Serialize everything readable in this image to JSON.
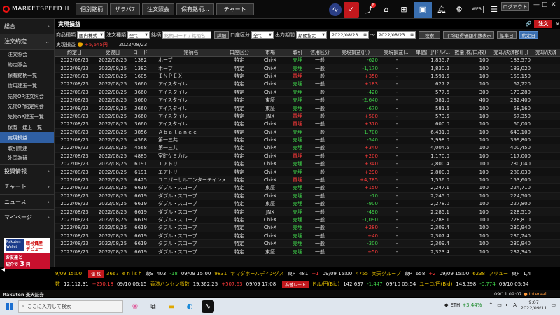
{
  "app": {
    "logo_text": "MARKETSPEED II",
    "tabs": [
      "個別銘柄",
      "ザラバ7",
      "注文照会",
      "保有銘柄...",
      "チャート"
    ],
    "logout": "ログアウト",
    "web_label": "WEB",
    "notification_badge": "N",
    "win_min": "—",
    "win_max": "□",
    "win_close": "✕"
  },
  "sidebar": {
    "sections": [
      {
        "label": "総合",
        "arrow": "›"
      },
      {
        "label": "注文約定",
        "arrow": "⌄"
      }
    ],
    "items": [
      "注文照会",
      "約定照会",
      "保有銘柄一覧",
      "信用建玉一覧",
      "先物OP注文照会",
      "先物OP約定照会",
      "先物OP建玉一覧",
      "保有・建玉一覧",
      "実現損益",
      "取引関連",
      "外国為替"
    ],
    "active_index": 8,
    "bottom_sections": [
      {
        "label": "投資情報",
        "arrow": "›"
      },
      {
        "label": "チャート",
        "arrow": "›"
      },
      {
        "label": "ニュース",
        "arrow": "›"
      },
      {
        "label": "マイページ",
        "arrow": "›"
      }
    ],
    "banner": {
      "brand": "Rakuten Wallet",
      "line1": "暗号資産",
      "line2": "デビュー",
      "line3": "お友達と",
      "line4": "紹介で",
      "amount": "3",
      "unit": "円"
    }
  },
  "panel": {
    "title": "実現損益",
    "link_icon": "🔗",
    "order_button": "注文",
    "filter": {
      "product_label": "商品種類",
      "product_value": "国内株式",
      "order_type_label": "注文種類",
      "order_type_value": "全て",
      "symbol_label": "銘柄",
      "symbol_placeholder": "銘柄コード / 銘柄名",
      "detail_button": "詳細",
      "account_label": "口座区分",
      "account_value": "全て",
      "period_label": "出力期間",
      "period_value": "期間指定",
      "date_from": "2022/08/23",
      "date_sep": "〜",
      "date_to": "2022/08/23",
      "search_button": "検索",
      "avg_button": "平均取得価額小数表示",
      "base_date_label": "基準日",
      "base_date_value": "約定日"
    },
    "summary": {
      "label": "実現損益",
      "help": "?",
      "value": "+5,645円",
      "date": "2022/08/23"
    }
  },
  "table": {
    "headers": [
      "約定日",
      "受渡日",
      "コード/...",
      "銘柄名",
      "口座区分",
      "市場",
      "取引",
      "信用区分",
      "実現損益(円)",
      "実現損益(...",
      "単価(円/ドル/...",
      "数量(株/口/枚)",
      "売却/決済額(円)",
      "売却/決済"
    ],
    "rows": [
      [
        "2022/08/23",
        "2022/08/25",
        "1382",
        "ホーブ",
        "特定",
        "Chi-X",
        "売埋",
        "一般",
        "-620",
        "-",
        "1,835.7",
        "100",
        "183,570"
      ],
      [
        "2022/08/23",
        "2022/08/25",
        "1382",
        "ホーブ",
        "特定",
        "Chi-X",
        "売埋",
        "一般",
        "-1,170",
        "-",
        "1,830.2",
        "100",
        "183,020"
      ],
      [
        "2022/08/23",
        "2022/08/25",
        "1605",
        "ＩＮＰＥＸ",
        "特定",
        "Chi-X",
        "買埋",
        "一般",
        "+350",
        "-",
        "1,591.5",
        "100",
        "159,150"
      ],
      [
        "2022/08/23",
        "2022/08/25",
        "3660",
        "アイスタイル",
        "特定",
        "Chi-X",
        "売埋",
        "一般",
        "+183",
        "-",
        "627.2",
        "100",
        "62,720"
      ],
      [
        "2022/08/23",
        "2022/08/25",
        "3660",
        "アイスタイル",
        "特定",
        "Chi-X",
        "売埋",
        "一般",
        "-420",
        "-",
        "577.6",
        "300",
        "173,280"
      ],
      [
        "2022/08/23",
        "2022/08/25",
        "3660",
        "アイスタイル",
        "特定",
        "東証",
        "売埋",
        "一般",
        "-2,640",
        "-",
        "581.0",
        "400",
        "232,400"
      ],
      [
        "2022/08/23",
        "2022/08/25",
        "3660",
        "アイスタイル",
        "特定",
        "東証",
        "売埋",
        "一般",
        "-670",
        "-",
        "581.6",
        "100",
        "58,160"
      ],
      [
        "2022/08/23",
        "2022/08/25",
        "3660",
        "アイスタイル",
        "特定",
        "JNX",
        "買埋",
        "一般",
        "+500",
        "-",
        "573.5",
        "100",
        "57,350"
      ],
      [
        "2022/08/23",
        "2022/08/25",
        "3660",
        "アイスタイル",
        "特定",
        "Chi-X",
        "買埋",
        "一般",
        "+370",
        "-",
        "600.0",
        "100",
        "60,000"
      ],
      [
        "2022/08/23",
        "2022/08/25",
        "3856",
        "Ａｂａｌａｎｃｅ",
        "特定",
        "Chi-X",
        "売埋",
        "一般",
        "-1,700",
        "-",
        "6,431.0",
        "100",
        "643,100"
      ],
      [
        "2022/08/23",
        "2022/08/25",
        "4568",
        "第一三共",
        "特定",
        "Chi-X",
        "売埋",
        "一般",
        "-540",
        "-",
        "3,998.0",
        "100",
        "399,800"
      ],
      [
        "2022/08/23",
        "2022/08/25",
        "4568",
        "第一三共",
        "特定",
        "Chi-X",
        "売埋",
        "一般",
        "+340",
        "-",
        "4,004.5",
        "100",
        "400,450"
      ],
      [
        "2022/08/23",
        "2022/08/25",
        "4885",
        "室町ケミカル",
        "特定",
        "Chi-X",
        "買埋",
        "一般",
        "+200",
        "-",
        "1,170.0",
        "100",
        "117,000"
      ],
      [
        "2022/08/23",
        "2022/08/25",
        "6191",
        "エアトリ",
        "特定",
        "Chi-X",
        "売埋",
        "一般",
        "+340",
        "-",
        "2,800.4",
        "100",
        "280,040"
      ],
      [
        "2022/08/23",
        "2022/08/25",
        "6191",
        "エアトリ",
        "特定",
        "Chi-X",
        "売埋",
        "一般",
        "+290",
        "-",
        "2,800.3",
        "100",
        "280,030"
      ],
      [
        "2022/08/23",
        "2022/08/25",
        "6425",
        "ユニバーサルエンターテインメン",
        "特定",
        "Chi-X",
        "買埋",
        "一般",
        "+4,785",
        "-",
        "1,536.0",
        "100",
        "153,600"
      ],
      [
        "2022/08/23",
        "2022/08/25",
        "6619",
        "ダブル・スコープ",
        "特定",
        "東証",
        "売埋",
        "一般",
        "+150",
        "-",
        "2,247.1",
        "100",
        "224,710"
      ],
      [
        "2022/08/23",
        "2022/08/25",
        "6619",
        "ダブル・スコープ",
        "特定",
        "Chi-X",
        "売埋",
        "一般",
        "-70",
        "-",
        "2,245.0",
        "100",
        "224,500"
      ],
      [
        "2022/08/23",
        "2022/08/25",
        "6619",
        "ダブル・スコープ",
        "特定",
        "東証",
        "売埋",
        "一般",
        "-900",
        "-",
        "2,278.0",
        "100",
        "227,800"
      ],
      [
        "2022/08/23",
        "2022/08/25",
        "6619",
        "ダブル・スコープ",
        "特定",
        "JNX",
        "売埋",
        "一般",
        "-490",
        "-",
        "2,285.1",
        "100",
        "228,510"
      ],
      [
        "2022/08/23",
        "2022/08/25",
        "6619",
        "ダブル・スコープ",
        "特定",
        "Chi-X",
        "売埋",
        "一般",
        "-1,090",
        "-",
        "2,288.1",
        "100",
        "228,810"
      ],
      [
        "2022/08/23",
        "2022/08/25",
        "6619",
        "ダブル・スコープ",
        "特定",
        "Chi-X",
        "売埋",
        "一般",
        "+280",
        "-",
        "2,309.4",
        "100",
        "230,940"
      ],
      [
        "2022/08/23",
        "2022/08/25",
        "6619",
        "ダブル・スコープ",
        "特定",
        "Chi-X",
        "売埋",
        "一般",
        "+40",
        "-",
        "2,307.4",
        "100",
        "230,740"
      ],
      [
        "2022/08/23",
        "2022/08/25",
        "6619",
        "ダブル・スコープ",
        "特定",
        "Chi-X",
        "売埋",
        "一般",
        "-300",
        "-",
        "2,309.4",
        "100",
        "230,940"
      ],
      [
        "2022/08/23",
        "2022/08/25",
        "6619",
        "ダブル・スコープ",
        "特定",
        "東証",
        "売埋",
        "一般",
        "+50",
        "-",
        "2,323.4",
        "100",
        "232,340"
      ]
    ]
  },
  "ticker": {
    "row1": {
      "time": "9/09 15:00",
      "chip": "値 株",
      "items": [
        {
          "code": "3667",
          "name": "e n i s h",
          "mkt": "東S",
          "price": "403",
          "chg": "-18",
          "time": "09/09 15:00"
        },
        {
          "code": "9831",
          "name": "ヤマダホールディングス",
          "mkt": "東P",
          "price": "481",
          "chg": "+1",
          "time": "09/09 15:00"
        },
        {
          "code": "4755",
          "name": "楽天グループ",
          "mkt": "東P",
          "price": "658",
          "chg": "+2",
          "time": "09/09 15:00"
        },
        {
          "code": "6238",
          "name": "フリュー",
          "mkt": "東P",
          "price": "1,4",
          "chg": "",
          "time": ""
        }
      ]
    },
    "row2": {
      "items": [
        {
          "name": "数",
          "price": "12,112.31",
          "chg": "+250.18",
          "time": "09/10 06:15"
        },
        {
          "name": "香港ハンセン指数",
          "price": "19,362.25",
          "chg": "+507.63",
          "time": "09/09 17:08"
        }
      ],
      "chip": "為替レート",
      "fx": [
        {
          "name": "ドル/円(Bid)",
          "price": "142.637",
          "chg": "-1.447",
          "time": "09/10 05:54"
        },
        {
          "name": "ユーロ/円(Bid)",
          "price": "143.298",
          "chg": "-0.774",
          "time": "09/10 05:54"
        }
      ]
    }
  },
  "statusbar": {
    "broker": "Rakuten 楽天証券",
    "datetime": "09/11 09:07",
    "interval": "Interval"
  },
  "taskbar": {
    "search_placeholder": "ここに入力して検索",
    "crypto": "ETH",
    "crypto_change": "+3.44%",
    "time": "9:07",
    "date": "2022/09/11",
    "lang": "A"
  }
}
